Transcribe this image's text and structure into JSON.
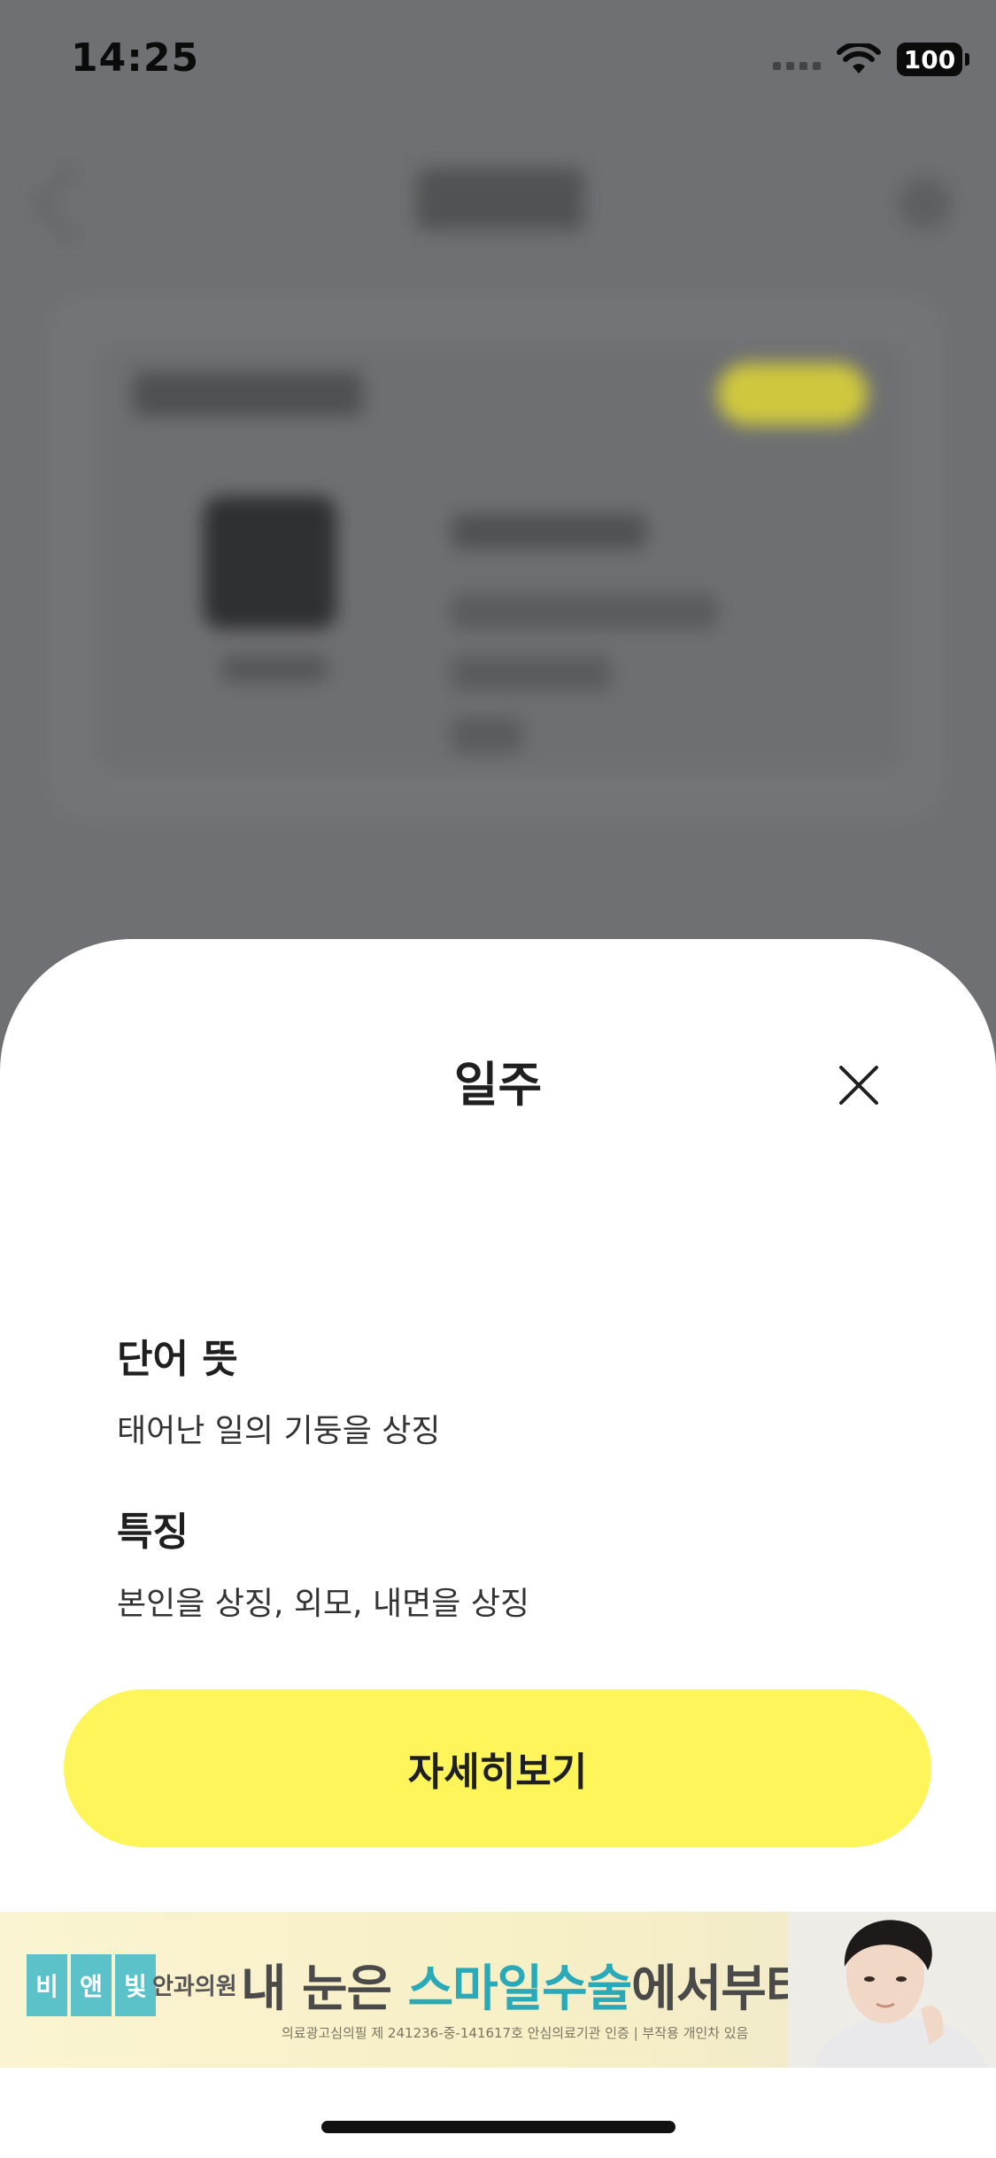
{
  "status_bar": {
    "time": "14:25",
    "battery": "100",
    "icons": [
      "cellular-signal-icon",
      "wifi-icon",
      "battery-icon"
    ]
  },
  "sheet": {
    "title": "일주",
    "close_icon": "close-icon",
    "sections": [
      {
        "title": "단어 뜻",
        "description": "태어난 일의 기둥을 상징"
      },
      {
        "title": "특징",
        "description": "본인을 상징, 외모, 내면을 상징"
      }
    ],
    "detail_button_label": "자세히보기"
  },
  "ad": {
    "logo_chars": [
      "비",
      "앤",
      "빛"
    ],
    "clinic_name": "안과의원",
    "headline_prefix": "내 눈은 ",
    "headline_highlight": "스마일수술",
    "headline_suffix": "에서부터",
    "fine_print": "의료광고심의필 제 241236-중-141617호 안심의료기관 인증 | 부작용 개인차 있음"
  },
  "colors": {
    "dim_overlay": "#6f7073",
    "sheet_background": "#ffffff",
    "primary_button": "#fdf55a",
    "ad_highlight": "#2aaab8",
    "text_primary": "#1f1f1f"
  }
}
